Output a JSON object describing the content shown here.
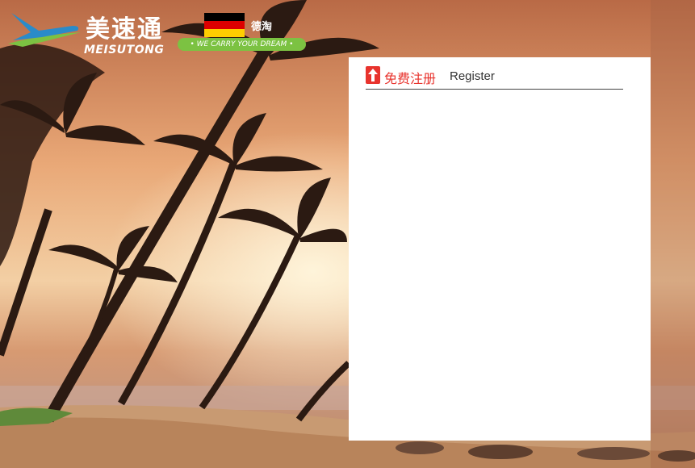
{
  "background": {
    "scene": "palm-beach-sunset",
    "colors": {
      "sky_top": "#d07a4c",
      "sky_mid": "#f0c28e",
      "sand": "#d6a57b",
      "palm": "#2b1a12"
    }
  },
  "brand": {
    "name_cn": "美速通",
    "name_en": "MEISUTONG",
    "tagline": "• WE CARRY YOUR DREAM •",
    "region_label": "德淘",
    "accent_green": "#7cc242",
    "accent_blue": "#2a8bc9"
  },
  "register": {
    "title_cn": "免费注册",
    "title_en": "Register",
    "accent": "#e8332d"
  }
}
